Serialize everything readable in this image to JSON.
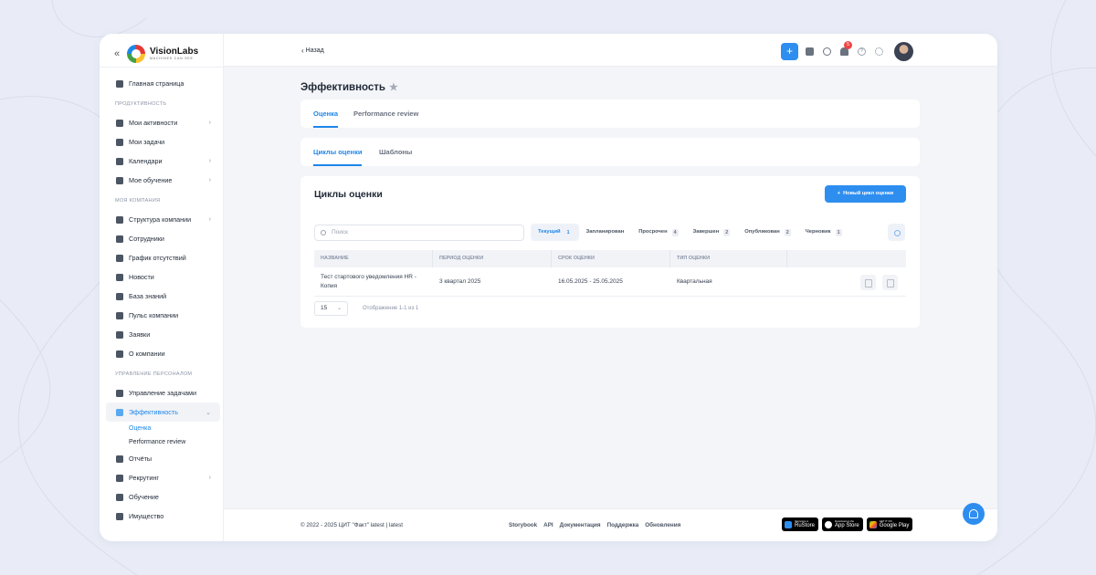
{
  "brand": {
    "name": "VisionLabs",
    "tagline": "MACHINES CAN SEE"
  },
  "topbar": {
    "back_label": "Назад",
    "notifications_count": "5",
    "help_glyph": "?"
  },
  "sidebar": {
    "home": "Главная страница",
    "sections": {
      "productivity": "ПРОДУКТИВНОСТЬ",
      "company": "МОЯ КОМПАНИЯ",
      "hr": "УПРАВЛЕНИЕ ПЕРСОНАЛОМ"
    },
    "items": {
      "activities": "Мои активности",
      "tasks": "Мои задачи",
      "calendars": "Календари",
      "learning": "Мое обучение",
      "structure": "Структура компании",
      "employees": "Сотрудники",
      "absences": "График отсутствий",
      "news": "Новости",
      "knowledge": "База знаний",
      "pulse": "Пульс компании",
      "requests": "Заявки",
      "about": "О компании",
      "task_mgmt": "Управление задачами",
      "performance": "Эффективность",
      "perf_sub_rating": "Оценка",
      "perf_sub_review": "Performance review",
      "reports": "Отчёты",
      "recruiting": "Рекрутинг",
      "training": "Обучение",
      "property": "Имущество"
    }
  },
  "page": {
    "title": "Эффективность",
    "tabs": [
      "Оценка",
      "Performance review"
    ],
    "subtabs": [
      "Циклы оценки",
      "Шаблоны"
    ],
    "content_title": "Циклы оценки",
    "new_button": "Новый цикл оценки",
    "search_placeholder": "Поиск",
    "filters": [
      {
        "label": "Текущий",
        "count": "1"
      },
      {
        "label": "Запланирован",
        "count": ""
      },
      {
        "label": "Просрочен",
        "count": "4"
      },
      {
        "label": "Завершен",
        "count": "2"
      },
      {
        "label": "Опубликован",
        "count": "2"
      },
      {
        "label": "Черновик",
        "count": "1"
      }
    ],
    "columns": [
      "НАЗВАНИЕ",
      "ПЕРИОД ОЦЕНКИ",
      "СРОК ОЦЕНКИ",
      "ТИП ОЦЕНКИ"
    ],
    "rows": [
      {
        "name": "Тест стартового уведомления HR - Копия",
        "period": "3 квартал 2025",
        "deadline": "16.05.2025 - 25.05.2025",
        "type": "Квартальная"
      }
    ],
    "page_size": "15",
    "pagination_info": "Отображение 1-1 из 1"
  },
  "footer": {
    "copyright": "© 2022 - 2025 ЦИТ \"Факт\"  latest | latest",
    "links": [
      "Storybook",
      "API",
      "Документация",
      "Поддержка",
      "Обновления"
    ],
    "stores": [
      {
        "small": "Загрузите в",
        "big": "RuStore"
      },
      {
        "small": "Download on the",
        "big": "App Store"
      },
      {
        "small": "GET IT ON",
        "big": "Google Play"
      }
    ]
  },
  "colors": {
    "accent": "#2e8ef0",
    "badge": "#ef4444",
    "background": "#e9ecf6"
  }
}
